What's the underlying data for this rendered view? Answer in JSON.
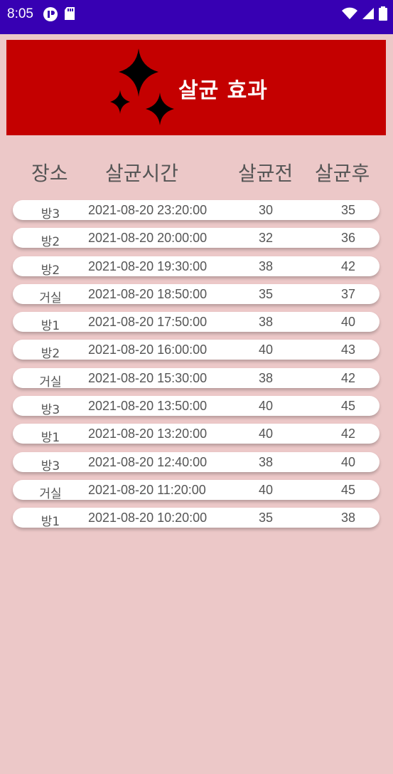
{
  "status_bar": {
    "time": "8:05",
    "icons_left": [
      "pause-circle-icon",
      "sd-card-icon"
    ],
    "icons_right": [
      "wifi-icon",
      "signal-icon",
      "battery-icon"
    ],
    "color": "#3700b3"
  },
  "banner": {
    "title": "살균 효과",
    "icon": "sparkles-icon",
    "background": "#c40000"
  },
  "table": {
    "headers": {
      "place": "장소",
      "time": "살균시간",
      "before": "살균전",
      "after": "살균후"
    },
    "rows": [
      {
        "place": "방3",
        "time": "2021-08-20 23:20:00",
        "before": "30",
        "after": "35"
      },
      {
        "place": "방2",
        "time": "2021-08-20 20:00:00",
        "before": "32",
        "after": "36"
      },
      {
        "place": "방2",
        "time": "2021-08-20 19:30:00",
        "before": "38",
        "after": "42"
      },
      {
        "place": "거실",
        "time": "2021-08-20 18:50:00",
        "before": "35",
        "after": "37"
      },
      {
        "place": "방1",
        "time": "2021-08-20 17:50:00",
        "before": "38",
        "after": "40"
      },
      {
        "place": "방2",
        "time": "2021-08-20 16:00:00",
        "before": "40",
        "after": "43"
      },
      {
        "place": "거실",
        "time": "2021-08-20 15:30:00",
        "before": "38",
        "after": "42"
      },
      {
        "place": "방3",
        "time": "2021-08-20 13:50:00",
        "before": "40",
        "after": "45"
      },
      {
        "place": "방1",
        "time": "2021-08-20 13:20:00",
        "before": "40",
        "after": "42"
      },
      {
        "place": "방3",
        "time": "2021-08-20 12:40:00",
        "before": "38",
        "after": "40"
      },
      {
        "place": "거실",
        "time": "2021-08-20 11:20:00",
        "before": "40",
        "after": "45"
      },
      {
        "place": "방1",
        "time": "2021-08-20 10:20:00",
        "before": "35",
        "after": "38"
      }
    ]
  }
}
